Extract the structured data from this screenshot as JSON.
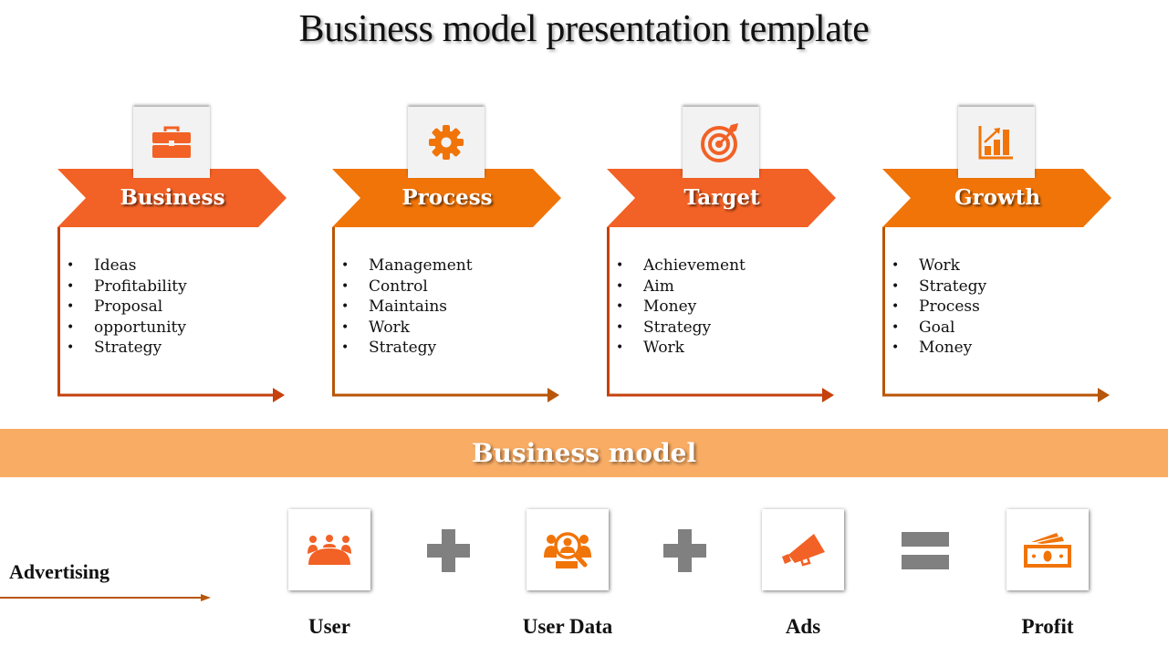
{
  "title": "Business model presentation template",
  "colors": {
    "banner_red_orange": "#f26125",
    "banner_orange": "#f07408",
    "bracket_red": "#c5410e",
    "bracket_brown": "#b8560a",
    "band": "#f9ac64",
    "operator_gray": "#808080"
  },
  "stages": [
    {
      "label": "Business",
      "icon": "briefcase-icon",
      "items": [
        "Ideas",
        "Profitability",
        "Proposal",
        "opportunity",
        "Strategy"
      ]
    },
    {
      "label": "Process",
      "icon": "gear-icon",
      "items": [
        "Management",
        "Control",
        "Maintains",
        "Work",
        "Strategy"
      ]
    },
    {
      "label": "Target",
      "icon": "target-icon",
      "items": [
        "Achievement",
        "Aim",
        "Money",
        "Strategy",
        "Work"
      ]
    },
    {
      "label": "Growth",
      "icon": "growth-chart-icon",
      "items": [
        "Work",
        "Strategy",
        "Process",
        "Goal",
        "Money"
      ]
    }
  ],
  "band": {
    "label": "Business model"
  },
  "advertising": {
    "label": "Advertising"
  },
  "equation": [
    {
      "label": "User",
      "icon": "user-group-icon"
    },
    {
      "operator": "plus-icon"
    },
    {
      "label": "User Data",
      "icon": "user-search-icon"
    },
    {
      "operator": "plus-icon"
    },
    {
      "label": "Ads",
      "icon": "megaphone-icon"
    },
    {
      "operator": "equals-icon"
    },
    {
      "label": "Profit",
      "icon": "money-icon"
    }
  ]
}
